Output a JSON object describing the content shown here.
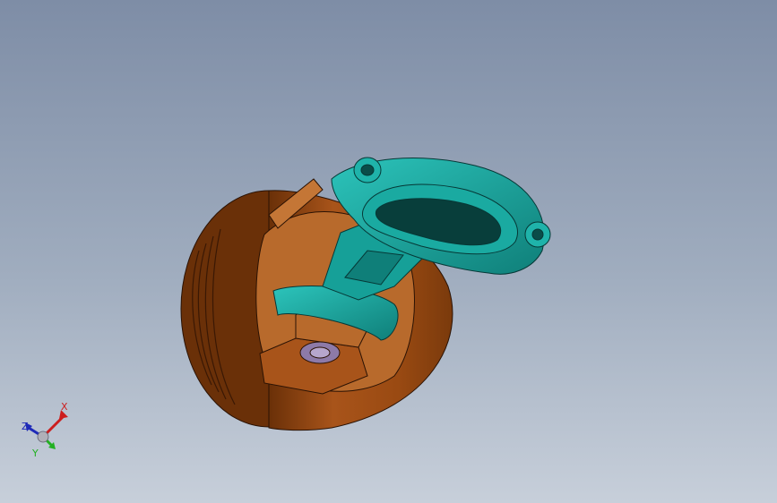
{
  "viewport": {
    "background_top": "#7e8da6",
    "background_bottom": "#c7cfda"
  },
  "model": {
    "piston_color": "#9a4a12",
    "piston_dark": "#5e2a06",
    "rod_color": "#17a39c",
    "rod_dark": "#0b5e5a",
    "pin_color": "#8d7aa8"
  },
  "triad": {
    "x_label": "X",
    "y_label": "Y",
    "z_label": "Z",
    "x_color": "#cc1e1e",
    "y_color": "#22b022",
    "z_color": "#1e2ab8"
  }
}
